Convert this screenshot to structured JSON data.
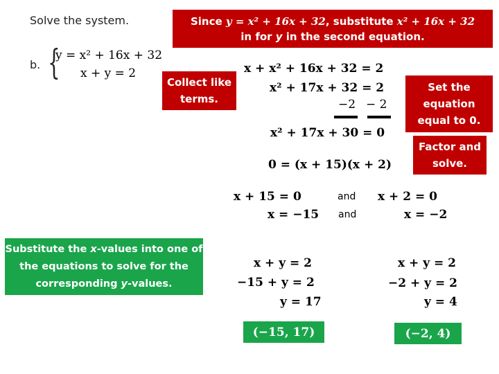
{
  "problem": {
    "heading": "Solve the system.",
    "part_label": "b.",
    "system": {
      "eq1": "y = x² + 16x + 32",
      "eq2": "x + y = 2"
    }
  },
  "callouts": {
    "substitute": {
      "line1_prefix": "Since ",
      "line1_eq": "y = x² + 16x + 32",
      "line1_mid": ", substitute ",
      "line1_expr": "x² + 16x + 32",
      "line2_pre": "in for ",
      "line2_var": "y",
      "line2_post": " in the second equation."
    },
    "collect": "Collect like terms.",
    "set_zero": "Set the equation equal to 0.",
    "factor": "Factor and solve.",
    "substitute_x": {
      "pre": "Substitute the ",
      "xvar": "x",
      "mid": "-values into one of the equations to solve for the corresponding ",
      "yvar": "y",
      "post": "-values."
    }
  },
  "steps": {
    "substituted": "x + x² + 16x + 32 = 2",
    "collected": "x² + 17x + 32 = 2",
    "subtract_left": "−2",
    "subtract_right": "− 2",
    "standard_form": "x² + 17x + 30 = 0",
    "factored": "0 = (x + 15)(x + 2)",
    "factor1_eq": "x + 15 = 0",
    "factor1_sol": "x = −15",
    "factor2_eq": "x + 2 = 0",
    "factor2_sol": "x = −2",
    "and1": "and",
    "and2": "and"
  },
  "back_substitution": {
    "left": {
      "line1": "x + y = 2",
      "line2": "−15 + y = 2",
      "line3": "y = 17",
      "solution": "(−15, 17)"
    },
    "right": {
      "line1": "x + y = 2",
      "line2": "−2 + y = 2",
      "line3": "y = 4",
      "solution": "(−2, 4)"
    }
  },
  "colors": {
    "red_callout": "#c00000",
    "green_callout": "#1aa54b"
  }
}
